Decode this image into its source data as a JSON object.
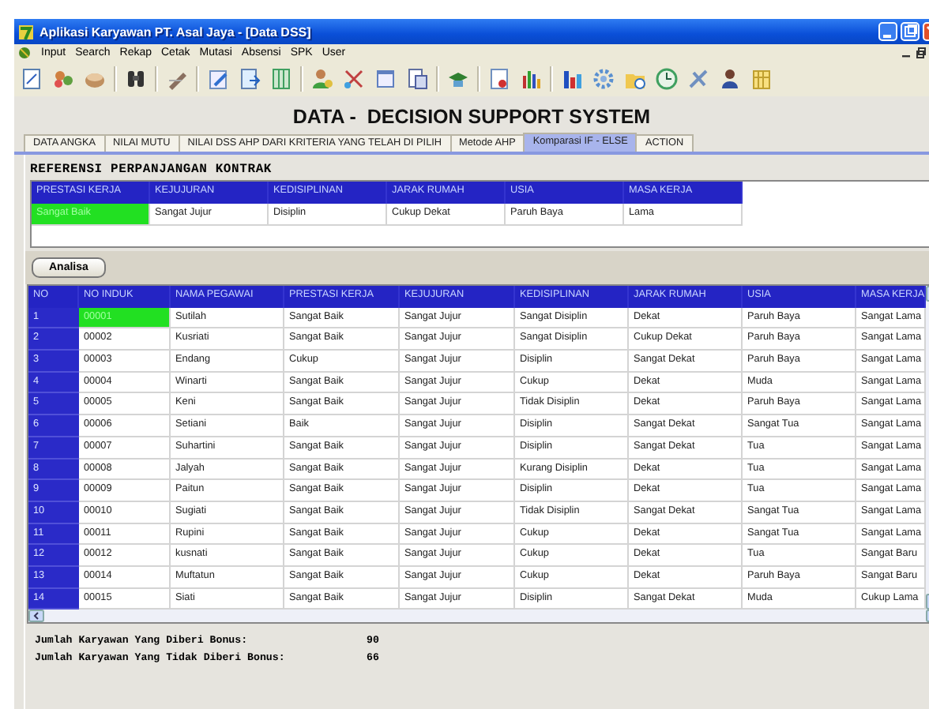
{
  "window": {
    "title": "Aplikasi Karyawan PT. Asal Jaya - [Data DSS]"
  },
  "menu": [
    "Input",
    "Search",
    "Rekap",
    "Cetak",
    "Mutasi",
    "Absensi",
    "SPK",
    "User"
  ],
  "heading": "DATA -  DECISION SUPPORT SYSTEM",
  "tabs": [
    {
      "label": "DATA ANGKA",
      "selected": false
    },
    {
      "label": "NILAI MUTU",
      "selected": false
    },
    {
      "label": "NILAI DSS AHP DARI KRITERIA YANG TELAH DI PILIH",
      "selected": false
    },
    {
      "label": "Metode AHP",
      "selected": false
    },
    {
      "label": "Komparasi IF - ELSE",
      "selected": true
    },
    {
      "label": "ACTION",
      "selected": false
    }
  ],
  "reference": {
    "title": "REFERENSI PERPANJANGAN KONTRAK",
    "columns": [
      "PRESTASI KERJA",
      "KEJUJURAN",
      "KEDISIPLINAN",
      "JARAK RUMAH",
      "USIA",
      "MASA KERJA"
    ],
    "rows": [
      {
        "highlighted": true,
        "cells": [
          "Sangat Baik",
          "Sangat Jujur",
          "Disiplin",
          "Cukup Dekat",
          "Paruh Baya",
          "Lama"
        ]
      }
    ]
  },
  "analyze_button": "Analisa",
  "employees": {
    "columns": [
      "NO",
      "NO INDUK",
      "NAMA PEGAWAI",
      "PRESTASI KERJA",
      "KEJUJURAN",
      "KEDISIPLINAN",
      "JARAK RUMAH",
      "USIA",
      "MASA KERJA"
    ],
    "rows": [
      {
        "highlighted": true,
        "cells": [
          "1",
          "00001",
          "Sutilah",
          "Sangat Baik",
          "Sangat Jujur",
          "Sangat Disiplin",
          "Dekat",
          "Paruh Baya",
          "Sangat Lama"
        ]
      },
      {
        "highlighted": false,
        "cells": [
          "2",
          "00002",
          "Kusriati",
          "Sangat Baik",
          "Sangat Jujur",
          "Sangat Disiplin",
          "Cukup Dekat",
          "Paruh Baya",
          "Sangat Lama"
        ]
      },
      {
        "highlighted": false,
        "cells": [
          "3",
          "00003",
          "Endang",
          "Cukup",
          "Sangat Jujur",
          "Disiplin",
          "Sangat Dekat",
          "Paruh Baya",
          "Sangat Lama"
        ]
      },
      {
        "highlighted": false,
        "cells": [
          "4",
          "00004",
          "Winarti",
          "Sangat Baik",
          "Sangat Jujur",
          "Cukup",
          "Dekat",
          "Muda",
          "Sangat Lama"
        ]
      },
      {
        "highlighted": false,
        "cells": [
          "5",
          "00005",
          "Keni",
          "Sangat Baik",
          "Sangat Jujur",
          "Tidak Disiplin",
          "Dekat",
          "Paruh Baya",
          "Sangat Lama"
        ]
      },
      {
        "highlighted": false,
        "cells": [
          "6",
          "00006",
          "Setiani",
          "Baik",
          "Sangat Jujur",
          "Disiplin",
          "Sangat Dekat",
          "Sangat Tua",
          "Sangat Lama"
        ]
      },
      {
        "highlighted": false,
        "cells": [
          "7",
          "00007",
          "Suhartini",
          "Sangat Baik",
          "Sangat Jujur",
          "Disiplin",
          "Sangat Dekat",
          "Tua",
          "Sangat Lama"
        ]
      },
      {
        "highlighted": false,
        "cells": [
          "8",
          "00008",
          "Jalyah",
          "Sangat Baik",
          "Sangat Jujur",
          "Kurang Disiplin",
          "Dekat",
          "Tua",
          "Sangat Lama"
        ]
      },
      {
        "highlighted": false,
        "cells": [
          "9",
          "00009",
          "Paitun",
          "Sangat Baik",
          "Sangat Jujur",
          "Disiplin",
          "Dekat",
          "Tua",
          "Sangat Lama"
        ]
      },
      {
        "highlighted": false,
        "cells": [
          "10",
          "00010",
          "Sugiati",
          "Sangat Baik",
          "Sangat Jujur",
          "Tidak Disiplin",
          "Sangat Dekat",
          "Sangat Tua",
          "Sangat Lama"
        ]
      },
      {
        "highlighted": false,
        "cells": [
          "11",
          "00011",
          "Rupini",
          "Sangat Baik",
          "Sangat Jujur",
          "Cukup",
          "Dekat",
          "Sangat Tua",
          "Sangat Lama"
        ]
      },
      {
        "highlighted": false,
        "cells": [
          "12",
          "00012",
          "kusnati",
          "Sangat Baik",
          "Sangat Jujur",
          "Cukup",
          "Dekat",
          "Tua",
          "Sangat Baru"
        ]
      },
      {
        "highlighted": false,
        "cells": [
          "13",
          "00014",
          "Muftatun",
          "Sangat Baik",
          "Sangat Jujur",
          "Cukup",
          "Dekat",
          "Paruh Baya",
          "Sangat Baru"
        ]
      },
      {
        "highlighted": false,
        "cells": [
          "14",
          "00015",
          "Siati",
          "Sangat Baik",
          "Sangat Jujur",
          "Disiplin",
          "Sangat Dekat",
          "Muda",
          "Cukup Lama"
        ]
      }
    ]
  },
  "totals": [
    {
      "label": "Jumlah Karyawan Yang Diberi Bonus:",
      "value": "90"
    },
    {
      "label": "Jumlah Karyawan Yang Tidak Diberi Bonus:",
      "value": "66"
    }
  ]
}
